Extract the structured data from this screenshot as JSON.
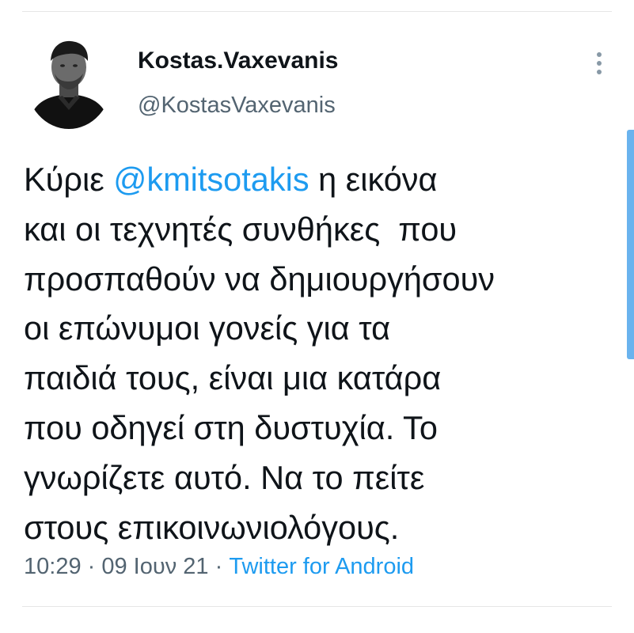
{
  "author": {
    "display_name": "Kostas.Vaxevanis",
    "handle": "@KostasVaxevanis"
  },
  "tweet": {
    "lines": [
      {
        "before": "Κύριε ",
        "mention": "@kmitsotakis",
        "after": " η εικόνα"
      },
      {
        "text": "και οι τεχνητές συνθήκες  που"
      },
      {
        "text": "προσπαθούν να δημιουργήσουν"
      },
      {
        "text": "οι επώνυμοι γονείς για τα"
      },
      {
        "text": "παιδιά τους, είναι μια κατάρα"
      },
      {
        "text": "που οδηγεί στη δυστυχία. Το"
      },
      {
        "text": "γνωρίζετε αυτό. Να το πείτε"
      },
      {
        "text": "στους επικοινωνιολόγους."
      }
    ]
  },
  "meta": {
    "time": "10:29",
    "separator": " · ",
    "date": "09 Ιουν 21",
    "separator2": " · ",
    "source": "Twitter for Android"
  },
  "icons": {
    "more": "more-vertical-icon",
    "avatar": "profile-photo"
  },
  "colors": {
    "link": "#1d9bf0",
    "secondary_text": "#536471",
    "primary_text": "#0f1419",
    "scroll_indicator": "#6ab3ee"
  }
}
